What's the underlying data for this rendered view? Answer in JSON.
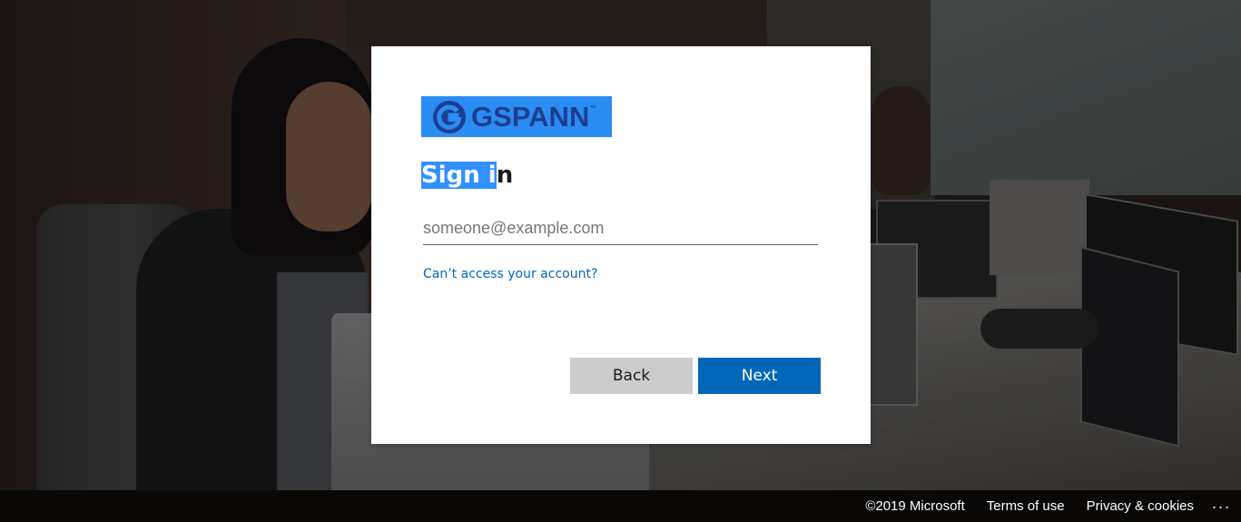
{
  "card": {
    "logo": {
      "text": "GSPANN",
      "trademark": "™",
      "background_color": "#2b8cf3",
      "text_color": "#1c3e8e"
    },
    "title_highlighted": "Sign i",
    "title_rest": "n",
    "email_field": {
      "value": "",
      "placeholder": "someone@example.com"
    },
    "help_link": "Can’t access your account?",
    "back_button": "Back",
    "next_button": "Next"
  },
  "footer": {
    "copyright": "©2019 Microsoft",
    "terms": "Terms of use",
    "privacy": "Privacy & cookies",
    "more": "..."
  },
  "colors": {
    "accent": "#0067b8",
    "selection": "#3390ff",
    "back_button": "#cccccc"
  },
  "icons": {
    "logo_mark": "gspann-g-logo-icon",
    "more": "ellipsis-icon"
  }
}
